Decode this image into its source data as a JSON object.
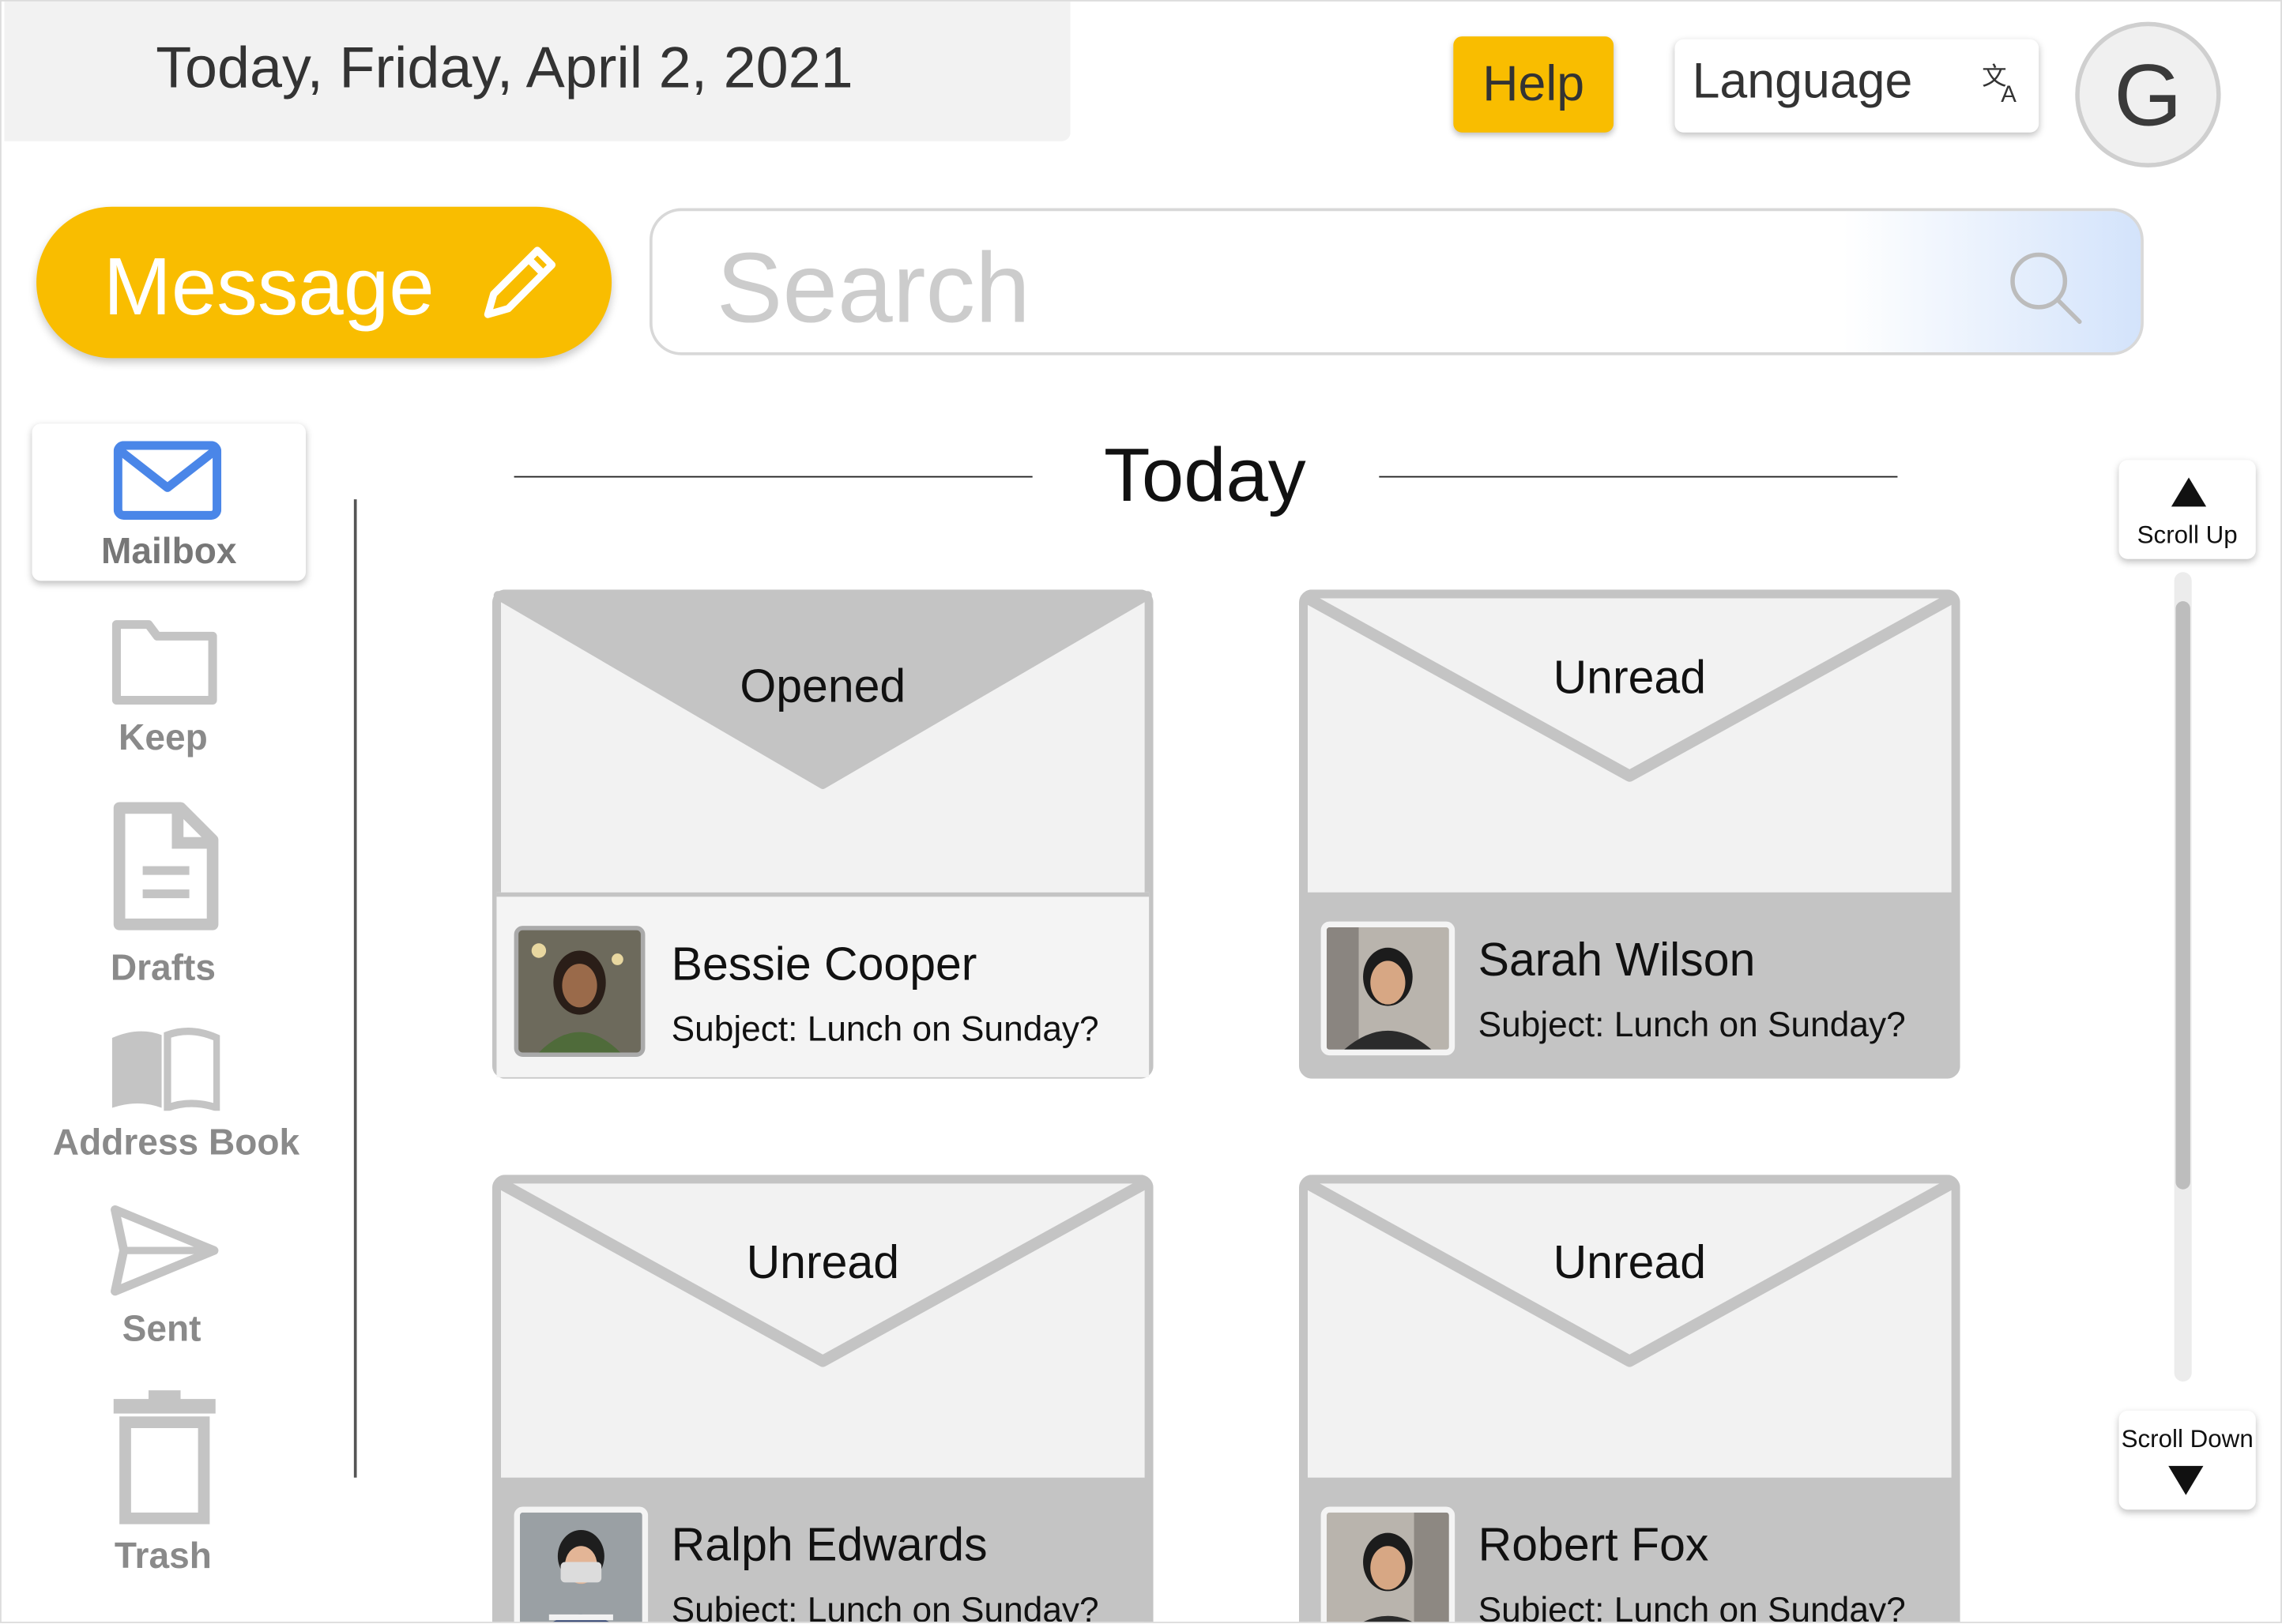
{
  "header": {
    "date": "Today, Friday, April 2, 2021",
    "help_label": "Help",
    "language_label": "Language",
    "account_initial": "G"
  },
  "compose": {
    "label": "Message"
  },
  "search": {
    "placeholder": "Search"
  },
  "sidebar": {
    "items": [
      {
        "label": "Mailbox",
        "icon": "mail-icon",
        "active": true
      },
      {
        "label": "Keep",
        "icon": "folder-icon"
      },
      {
        "label": "Drafts",
        "icon": "document-icon"
      },
      {
        "label": "Address Book",
        "icon": "book-icon"
      },
      {
        "label": "Sent",
        "icon": "send-icon"
      },
      {
        "label": "Trash",
        "icon": "trash-icon"
      }
    ]
  },
  "section": {
    "title": "Today"
  },
  "messages": [
    {
      "status": "Opened",
      "sender": "Bessie Cooper",
      "subject": "Subject: Lunch on Sunday?"
    },
    {
      "status": "Unread",
      "sender": "Sarah Wilson",
      "subject": "Subject: Lunch on Sunday?"
    },
    {
      "status": "Unread",
      "sender": "Ralph Edwards",
      "subject": "Subject: Lunch on Sunday?"
    },
    {
      "status": "Unread",
      "sender": "Robert Fox",
      "subject": "Subject: Lunch on Sunday?"
    }
  ],
  "scroll": {
    "up_label": "Scroll Up",
    "down_label": "Scroll Down"
  },
  "colors": {
    "accent": "#f9bd00",
    "active_icon": "#4a86e8",
    "inactive_icon": "#c4c4c4"
  }
}
